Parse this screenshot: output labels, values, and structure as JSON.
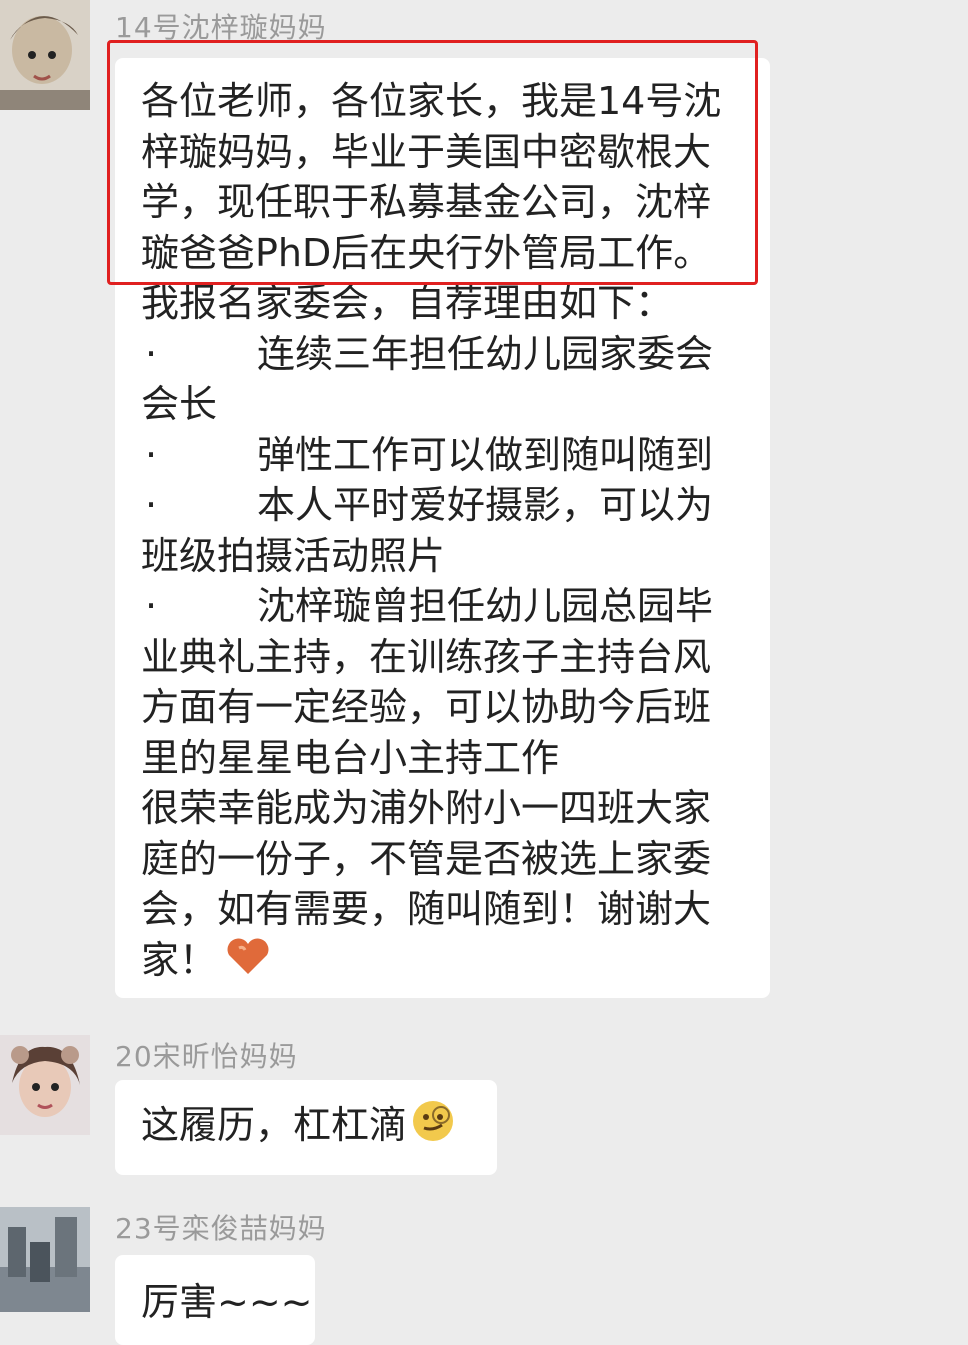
{
  "messages": [
    {
      "sender": "14号沈梓璇妈妈",
      "highlight_lines": [
        "各位老师，各位家长，我是14号沈",
        "梓璇妈妈，毕业于美国中密歇根大",
        "学，现任职于私募基金公司，沈梓",
        "璇爸爸PhD后在央行外管局工作。"
      ],
      "intro": "我报名家委会，自荐理由如下：",
      "bullet_symbol": "·",
      "bullet1_a": "连续三年担任幼儿园家委会",
      "bullet1_b": "会长",
      "bullet2": "弹性工作可以做到随叫随到",
      "bullet3_a": "本人平时爱好摄影，可以为",
      "bullet3_b": "班级拍摄活动照片",
      "bullet4_a": "沈梓璇曾担任幼儿园总园毕",
      "bullet4_b": "业典礼主持，在训练孩子主持台风",
      "bullet4_c": "方面有一定经验，可以协助今后班",
      "bullet4_d": "里的星星电台小主持工作",
      "closing_a": "很荣幸能成为浦外附小一四班大家",
      "closing_b": "庭的一份子，不管是否被选上家委",
      "closing_c": "会，如有需要，随叫随到！谢谢大",
      "closing_d": "家！",
      "heart_icon": "heart-icon"
    },
    {
      "sender": "20宋昕怡妈妈",
      "text": "这履历，杠杠滴",
      "emoji_icon": "smirk-emoji-icon"
    },
    {
      "sender": "23号栾俊喆妈妈",
      "text": "厉害~~~"
    }
  ],
  "colors": {
    "highlight": "#e02020",
    "bubble": "#ffffff",
    "background": "#ececec",
    "sender": "#9a9a9a"
  }
}
